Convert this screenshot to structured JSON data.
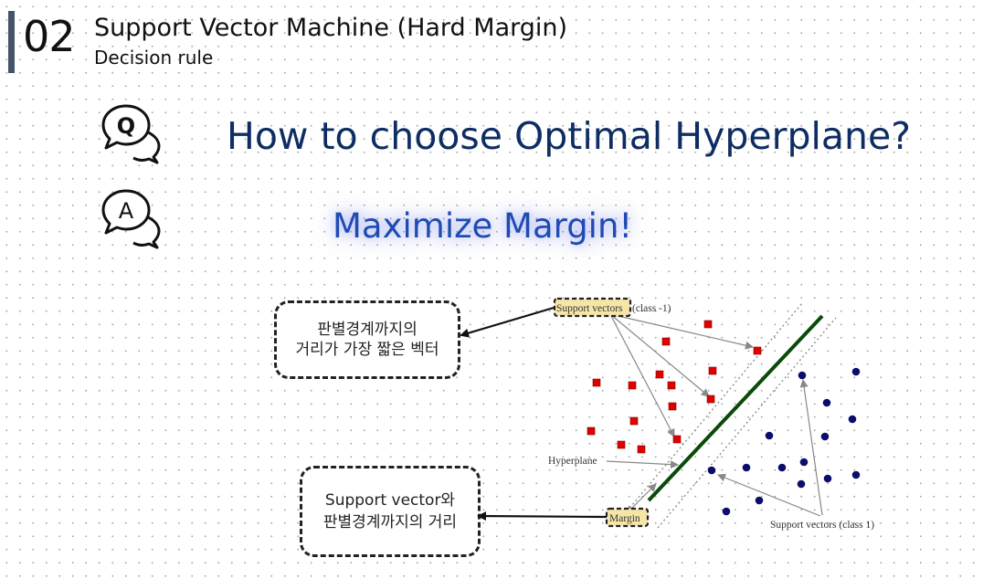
{
  "header": {
    "section_number": "02",
    "title": "Support Vector Machine (Hard Margin)",
    "subtitle": "Decision rule"
  },
  "question": {
    "icon_letter": "Q",
    "text": "How to choose Optimal Hyperplane?"
  },
  "answer": {
    "icon_letter": "A",
    "text": "Maximize Margin!",
    "color": "#1f4bb3"
  },
  "notes": {
    "top": {
      "line1": "판별경계까지의",
      "line2": "거리가 가장 짧은 벡터"
    },
    "bottom": {
      "line1": "Support vector와",
      "line2": "판별경계까지의 거리"
    }
  },
  "diagram": {
    "labels": {
      "support_vectors_neg": "Support vectors",
      "class_neg": "(class -1)",
      "hyperplane": "Hyperplane",
      "margin": "Margin",
      "support_vectors_pos": "Support vectors (class 1)"
    },
    "colors": {
      "class_neg": "#e00000",
      "class_pos": "#0c0c6e",
      "hyperplane": "#0a4a0a",
      "highlight": "#f5e6a8"
    }
  }
}
